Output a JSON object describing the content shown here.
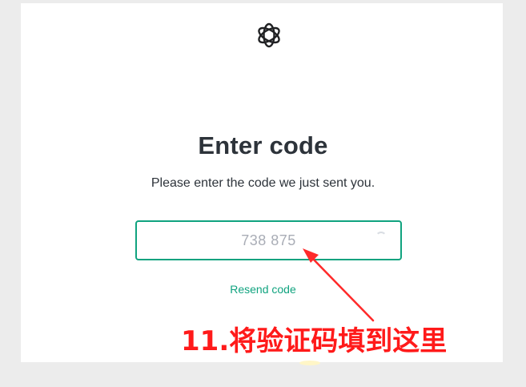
{
  "login": {
    "title": "Enter code",
    "subtitle": "Please enter the code we just sent you.",
    "code_placeholder": "738 875",
    "resend_label": "Resend code",
    "accent_color": "#10a37f",
    "logo_icon": "openai-logo-icon"
  },
  "annotation": {
    "text": "11.将验证码填到这里",
    "color": "#ff1a1a",
    "arrow_icon": "red-arrow-icon"
  }
}
